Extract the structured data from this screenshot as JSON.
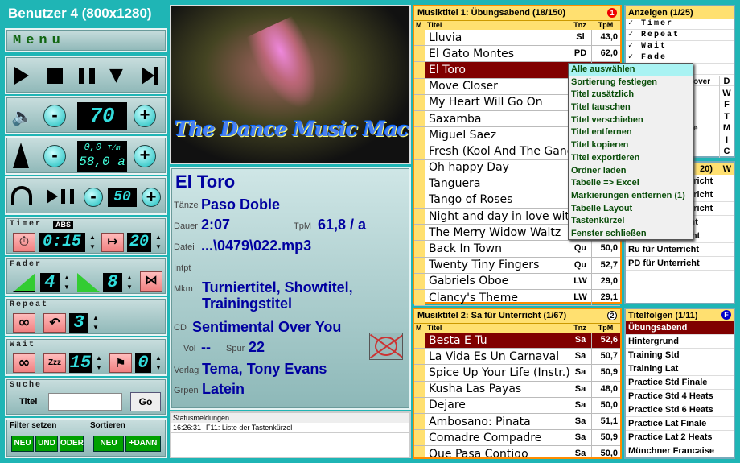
{
  "window_title": "Benutzer 4 (800x1280)",
  "menu_label": "Menu",
  "volume": "70",
  "tempo": {
    "tpm": "0,0",
    "unit": "T/m",
    "value": "58,0 a"
  },
  "speed": "50",
  "timer": {
    "label": "Timer",
    "abs": "ABS",
    "time": "0:15",
    "end": "20"
  },
  "fader": {
    "label": "Fader",
    "in": "4",
    "out": "8"
  },
  "repeat": {
    "label": "Repeat",
    "value": "3"
  },
  "wait": {
    "label": "Wait",
    "zzz": "Zzz",
    "time": "15",
    "bell": "0"
  },
  "suche": {
    "label": "Suche",
    "titel_label": "Titel",
    "go": "Go",
    "value": ""
  },
  "filter": {
    "label": "Filter setzen",
    "neu": "NEU",
    "und": "UND",
    "oder": "ODER"
  },
  "sortieren": {
    "label": "Sortieren",
    "neu": "NEU",
    "dann": "+DANN"
  },
  "banner": "The Dance Music Machine",
  "track": {
    "title": "El Toro",
    "taenze_label": "Tänze",
    "taenze": "Paso Doble",
    "dauer_label": "Dauer",
    "dauer": "2:07",
    "tpm_label": "TpM",
    "tpm": "61,8 / a",
    "datei_label": "Datei",
    "datei": "...\\0479\\022.mp3",
    "intpt_label": "Intpt",
    "mkm_label": "Mkm",
    "mkm": "Turniertitel, Showtitel, Trainingstitel",
    "cd_label": "CD",
    "cd": "Sentimental Over You",
    "vol_label": "Vol",
    "vol": "--",
    "spur_label": "Spur",
    "spur": "22",
    "verlag_label": "Verlag",
    "verlag": "Tema, Tony Evans",
    "grpen_label": "Grpen",
    "grpen": "Latein"
  },
  "status": {
    "title": "Statusmeldungen",
    "time": "16:26:31",
    "msg": "F11: Liste der Tastenkürzel"
  },
  "list1": {
    "title": "Musiktitel 1: Übungsabend (18/150)",
    "badge": "1",
    "col_m": "M",
    "col_titel": "Titel",
    "col_tnz": "Tnz",
    "col_tpm": "TpM",
    "rows": [
      {
        "t": "Lluvia",
        "z": "Sl",
        "p": "43,0"
      },
      {
        "t": "El Gato Montes",
        "z": "PD",
        "p": "62,0"
      },
      {
        "t": "El Toro",
        "z": "PD",
        "p": "61,8"
      },
      {
        "t": "Move Closer",
        "z": "",
        "p": ""
      },
      {
        "t": "My Heart Will Go On",
        "z": "",
        "p": ""
      },
      {
        "t": "Saxamba",
        "z": "",
        "p": ""
      },
      {
        "t": "Miguel Saez",
        "z": "",
        "p": ""
      },
      {
        "t": "Fresh (Kool And The Gang)",
        "z": "",
        "p": ""
      },
      {
        "t": "Oh happy Day",
        "z": "",
        "p": ""
      },
      {
        "t": "Tanguera",
        "z": "",
        "p": ""
      },
      {
        "t": "Tango of Roses",
        "z": "",
        "p": ""
      },
      {
        "t": "Night and day in love with you",
        "z": "",
        "p": ""
      },
      {
        "t": "The Merry Widow Waltz",
        "z": "",
        "p": ""
      },
      {
        "t": "Back In Town",
        "z": "Qu",
        "p": "50,0"
      },
      {
        "t": "Twenty Tiny Fingers",
        "z": "Qu",
        "p": "52,7"
      },
      {
        "t": "Gabriels Oboe",
        "z": "LW",
        "p": "29,0"
      },
      {
        "t": "Clancy's Theme",
        "z": "LW",
        "p": "29,1"
      }
    ]
  },
  "list2": {
    "title": "Musiktitel 2:  Sa für Unterricht (1/67)",
    "badge": "2",
    "col_m": "M",
    "col_titel": "Titel",
    "col_tnz": "Tnz",
    "col_tpm": "TpM",
    "rows": [
      {
        "t": "Besta E Tu",
        "z": "Sa",
        "p": "52,6"
      },
      {
        "t": "La Vida Es Un Carnaval",
        "z": "Sa",
        "p": "50,7"
      },
      {
        "t": "Spice Up Your Life (Instr.)",
        "z": "Sa",
        "p": "50,9"
      },
      {
        "t": "Kusha Las Payas",
        "z": "Sa",
        "p": "48,0"
      },
      {
        "t": "Dejare",
        "z": "Sa",
        "p": "50,0"
      },
      {
        "t": "Ambosano: Pinata",
        "z": "Sa",
        "p": "51,1"
      },
      {
        "t": "Comadre Compadre",
        "z": "Sa",
        "p": "50,9"
      },
      {
        "t": "Que Pasa Contigo",
        "z": "Sa",
        "p": "50,0"
      }
    ]
  },
  "context_menu": [
    "Alle auswählen",
    "Sortierung festlegen",
    "Titel zusätzlich",
    "Titel tauschen",
    "Titel verschieben",
    "Titel entfernen",
    "Titel kopieren",
    "Titel exportieren",
    "Ordner laden",
    "Tabelle => Excel",
    "Markierungen entfernen (1)",
    "Tabelle Layout",
    "Tastenkürzel",
    "Fenster schließen"
  ],
  "anzeigen": {
    "title": "Anzeigen (1/25)",
    "items": [
      "Timer",
      "Repeat",
      "Wait",
      "Fade"
    ],
    "partial": [
      "over",
      "e"
    ],
    "keys": [
      "D",
      "W",
      "F",
      "T",
      "M",
      "I",
      "C"
    ]
  },
  "mid": {
    "count": "20)",
    "badge": "W",
    "items": [
      "rricht",
      "rricht",
      "rricht",
      "Sa für Unterricht",
      "CC für Unterricht",
      "Ru für Unterricht",
      "PD für Unterricht"
    ]
  },
  "folgen": {
    "title": "Titelfolgen (1/11)",
    "badge": "F",
    "items": [
      "Übungsabend",
      "Hintergrund",
      "Training Std",
      "Training Lat",
      "Practice Std Finale",
      "Practice Std 4 Heats",
      "Practice Std 6 Heats",
      "Practice Lat Finale",
      "Practice Lat 2 Heats",
      "Münchner Francaise"
    ]
  },
  "colors": {
    "teal": "#1fb5b5",
    "orange": "#ff8c00",
    "selected": "#800000",
    "header": "#ffe070",
    "blue_text": "#0000a0"
  }
}
